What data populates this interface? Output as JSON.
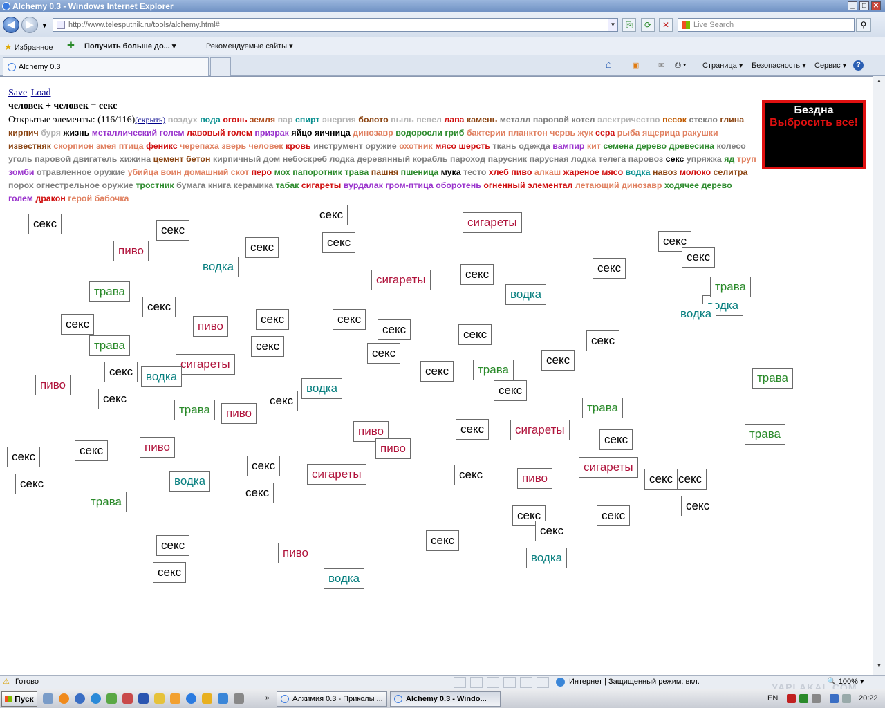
{
  "window": {
    "title": "Alchemy 0.3 - Windows Internet Explorer",
    "min": "_",
    "max": "□",
    "close": "✕"
  },
  "address": {
    "url": "http://www.telesputnik.ru/tools/alchemy.html#",
    "search_placeholder": "Live Search"
  },
  "favorites": {
    "label": "Избранное",
    "get_more": "Получить больше до...",
    "recommended": "Рекомендуемые сайты"
  },
  "tab": {
    "title": "Alchemy 0.3"
  },
  "commands": {
    "page": "Страница ▾",
    "security": "Безопасность ▾",
    "service": "Сервис ▾",
    "help": "?"
  },
  "page": {
    "save": "Save",
    "load": "Load",
    "recipe": "человек + человек = секс",
    "open_prefix": "Открытые элементы: (116/116)",
    "hide": "(скрыть)",
    "abyss_title": "Бездна",
    "abyss_discard": "Выбросить все!"
  },
  "elements": [
    {
      "t": "воздух",
      "c": "#b3b3b3"
    },
    {
      "t": "вода",
      "c": "#0a9090"
    },
    {
      "t": "огонь",
      "c": "#d01010"
    },
    {
      "t": "земля",
      "c": "#b05020"
    },
    {
      "t": "пар",
      "c": "#b3b3b3"
    },
    {
      "t": "спирт",
      "c": "#0a9090"
    },
    {
      "t": "энергия",
      "c": "#b3b3b3"
    },
    {
      "t": "болото",
      "c": "#8b4513"
    },
    {
      "t": "пыль",
      "c": "#b3b3b3"
    },
    {
      "t": "пепел",
      "c": "#b3b3b3"
    },
    {
      "t": "лава",
      "c": "#d01010"
    },
    {
      "t": "камень",
      "c": "#8b4513"
    },
    {
      "t": "металл",
      "c": "#808080"
    },
    {
      "t": "паровой котел",
      "c": "#808080"
    },
    {
      "t": "электричество",
      "c": "#b3b3b3"
    },
    {
      "t": "песок",
      "c": "#c05a00"
    },
    {
      "t": "стекло",
      "c": "#808080"
    },
    {
      "t": "глина",
      "c": "#8b4513"
    },
    {
      "t": "кирпич",
      "c": "#8b4513"
    },
    {
      "t": "буря",
      "c": "#b3b3b3"
    },
    {
      "t": "жизнь",
      "c": "#000"
    },
    {
      "t": "металлический голем",
      "c": "#9932cc"
    },
    {
      "t": "лавовый голем",
      "c": "#d01010"
    },
    {
      "t": "призрак",
      "c": "#9932cc"
    },
    {
      "t": "яйцо",
      "c": "#000"
    },
    {
      "t": "яичница",
      "c": "#000"
    },
    {
      "t": "динозавр",
      "c": "#e08060"
    },
    {
      "t": "водоросли",
      "c": "#2e8b2e"
    },
    {
      "t": "гриб",
      "c": "#2e8b2e"
    },
    {
      "t": "бактерии",
      "c": "#e08060"
    },
    {
      "t": "планктон",
      "c": "#e08060"
    },
    {
      "t": "червь",
      "c": "#e08060"
    },
    {
      "t": "жук",
      "c": "#e08060"
    },
    {
      "t": "сера",
      "c": "#d01010"
    },
    {
      "t": "рыба",
      "c": "#e08060"
    },
    {
      "t": "ящерица",
      "c": "#e08060"
    },
    {
      "t": "ракушки",
      "c": "#e08060"
    },
    {
      "t": "известняк",
      "c": "#8b4513"
    },
    {
      "t": "скорпион",
      "c": "#e08060"
    },
    {
      "t": "змея",
      "c": "#e08060"
    },
    {
      "t": "птица",
      "c": "#e08060"
    },
    {
      "t": "феникс",
      "c": "#d01010"
    },
    {
      "t": "черепаха",
      "c": "#e08060"
    },
    {
      "t": "зверь",
      "c": "#e08060"
    },
    {
      "t": "человек",
      "c": "#e08060"
    },
    {
      "t": "кровь",
      "c": "#d01010"
    },
    {
      "t": "инструмент",
      "c": "#808080"
    },
    {
      "t": "оружие",
      "c": "#808080"
    },
    {
      "t": "охотник",
      "c": "#e08060"
    },
    {
      "t": "мясо",
      "c": "#d01010"
    },
    {
      "t": "шерсть",
      "c": "#d01010"
    },
    {
      "t": "ткань",
      "c": "#808080"
    },
    {
      "t": "одежда",
      "c": "#808080"
    },
    {
      "t": "вампир",
      "c": "#9932cc"
    },
    {
      "t": "кит",
      "c": "#e08060"
    },
    {
      "t": "семена",
      "c": "#2e8b2e"
    },
    {
      "t": "дерево",
      "c": "#2e8b2e"
    },
    {
      "t": "древесина",
      "c": "#2e8b2e"
    },
    {
      "t": "колесо",
      "c": "#808080"
    },
    {
      "t": "уголь",
      "c": "#808080"
    },
    {
      "t": "паровой двигатель",
      "c": "#808080"
    },
    {
      "t": "хижина",
      "c": "#808080"
    },
    {
      "t": "цемент",
      "c": "#8b4513"
    },
    {
      "t": "бетон",
      "c": "#8b4513"
    },
    {
      "t": "кирпичный дом",
      "c": "#808080"
    },
    {
      "t": "небоскреб",
      "c": "#808080"
    },
    {
      "t": "лодка",
      "c": "#808080"
    },
    {
      "t": "деревянный корабль",
      "c": "#808080"
    },
    {
      "t": "пароход",
      "c": "#808080"
    },
    {
      "t": "парусник",
      "c": "#808080"
    },
    {
      "t": "парусная лодка",
      "c": "#808080"
    },
    {
      "t": "телега",
      "c": "#808080"
    },
    {
      "t": "паровоз",
      "c": "#808080"
    },
    {
      "t": "секс",
      "c": "#000"
    },
    {
      "t": "упряжка",
      "c": "#808080"
    },
    {
      "t": "яд",
      "c": "#2e8b2e"
    },
    {
      "t": "труп",
      "c": "#e08060"
    },
    {
      "t": "зомби",
      "c": "#9932cc"
    },
    {
      "t": "отравленное оружие",
      "c": "#808080"
    },
    {
      "t": "убийца",
      "c": "#e08060"
    },
    {
      "t": "воин",
      "c": "#e08060"
    },
    {
      "t": "домашний скот",
      "c": "#e08060"
    },
    {
      "t": "перо",
      "c": "#d01010"
    },
    {
      "t": "мох",
      "c": "#2e8b2e"
    },
    {
      "t": "папоротник",
      "c": "#2e8b2e"
    },
    {
      "t": "трава",
      "c": "#2e8b2e"
    },
    {
      "t": "пашня",
      "c": "#8b4513"
    },
    {
      "t": "пшеница",
      "c": "#2e8b2e"
    },
    {
      "t": "мука",
      "c": "#000"
    },
    {
      "t": "тесто",
      "c": "#808080"
    },
    {
      "t": "хлеб",
      "c": "#d01010"
    },
    {
      "t": "пиво",
      "c": "#d01010"
    },
    {
      "t": "алкаш",
      "c": "#e08060"
    },
    {
      "t": "жареное мясо",
      "c": "#d01010"
    },
    {
      "t": "водка",
      "c": "#0a9090"
    },
    {
      "t": "навоз",
      "c": "#8b4513"
    },
    {
      "t": "молоко",
      "c": "#d01010"
    },
    {
      "t": "селитра",
      "c": "#8b4513"
    },
    {
      "t": "порох",
      "c": "#808080"
    },
    {
      "t": "огнестрельное оружие",
      "c": "#808080"
    },
    {
      "t": "тростник",
      "c": "#2e8b2e"
    },
    {
      "t": "бумага",
      "c": "#808080"
    },
    {
      "t": "книга",
      "c": "#808080"
    },
    {
      "t": "керамика",
      "c": "#808080"
    },
    {
      "t": "табак",
      "c": "#2e8b2e"
    },
    {
      "t": "сигареты",
      "c": "#d01010"
    },
    {
      "t": "вурдалак",
      "c": "#9932cc"
    },
    {
      "t": "гром-птица",
      "c": "#9932cc"
    },
    {
      "t": "оборотень",
      "c": "#9932cc"
    },
    {
      "t": "огненный элементал",
      "c": "#d01010"
    },
    {
      "t": "летающий динозавр",
      "c": "#e08060"
    },
    {
      "t": "ходячее дерево",
      "c": "#2e8b2e"
    },
    {
      "t": "голем",
      "c": "#9932cc"
    },
    {
      "t": "дракон",
      "c": "#d01010"
    },
    {
      "t": "герой",
      "c": "#e08060"
    },
    {
      "t": "бабочка",
      "c": "#e08060"
    }
  ],
  "chip_colors": {
    "секс": "#000000",
    "пиво": "#b0143c",
    "водка": "#0a8080",
    "трава": "#2a8a2a",
    "сигареты": "#b0143c"
  },
  "workspace": [
    {
      "t": "секс"
    },
    {
      "t": "секс"
    },
    {
      "t": "секс"
    },
    {
      "t": "сигареты"
    },
    {
      "t": "пиво"
    },
    {
      "t": "секс"
    },
    {
      "t": "секс"
    },
    {
      "t": "секс"
    },
    {
      "t": "водка"
    },
    {
      "t": "секс"
    },
    {
      "t": "сигареты"
    },
    {
      "t": "секс"
    },
    {
      "t": "секс"
    },
    {
      "t": "водка"
    },
    {
      "t": "трава"
    },
    {
      "t": "секс"
    },
    {
      "t": "водка"
    },
    {
      "t": "трава"
    },
    {
      "t": "водка"
    },
    {
      "t": "секс"
    },
    {
      "t": "пиво"
    },
    {
      "t": "секс"
    },
    {
      "t": "секс"
    },
    {
      "t": "секс"
    },
    {
      "t": "трава"
    },
    {
      "t": "секс"
    },
    {
      "t": "секс"
    },
    {
      "t": "секс"
    },
    {
      "t": "сигареты"
    },
    {
      "t": "водка"
    },
    {
      "t": "секс"
    },
    {
      "t": "трава"
    },
    {
      "t": "секс"
    },
    {
      "t": "секс"
    },
    {
      "t": "секс"
    },
    {
      "t": "трава"
    },
    {
      "t": "пиво"
    },
    {
      "t": "водка"
    },
    {
      "t": "секс"
    },
    {
      "t": "секс"
    },
    {
      "t": "трава"
    },
    {
      "t": "пиво"
    },
    {
      "t": "секс"
    },
    {
      "t": "трава"
    },
    {
      "t": "пиво"
    },
    {
      "t": "пиво"
    },
    {
      "t": "секс"
    },
    {
      "t": "сигареты"
    },
    {
      "t": "секс"
    },
    {
      "t": "секс"
    },
    {
      "t": "пиво"
    },
    {
      "t": "секс"
    },
    {
      "t": "трава"
    },
    {
      "t": "секс"
    },
    {
      "t": "водка"
    },
    {
      "t": "секс"
    },
    {
      "t": "секс"
    },
    {
      "t": "сигареты"
    },
    {
      "t": "секс"
    },
    {
      "t": "пиво"
    },
    {
      "t": "сигареты"
    },
    {
      "t": "секс"
    },
    {
      "t": "трава"
    },
    {
      "t": "секс"
    },
    {
      "t": "секс"
    },
    {
      "t": "секс"
    },
    {
      "t": "секс"
    },
    {
      "t": "секс"
    },
    {
      "t": "водка"
    },
    {
      "t": "секс"
    },
    {
      "t": "пиво"
    },
    {
      "t": "водка"
    },
    {
      "t": "секс"
    },
    {
      "t": "секс"
    }
  ],
  "status": {
    "ready": "Готово",
    "zone": "Интернет | Защищенный режим: вкл.",
    "zoom": "100%"
  },
  "taskbar": {
    "start": "Пуск",
    "task1": "Алхимия 0.3 - Приколы ...",
    "task2": "Alchemy 0.3 - Windo...",
    "lang": "EN",
    "clock": "20:22"
  },
  "watermark": "YAPLAKAL.COM"
}
